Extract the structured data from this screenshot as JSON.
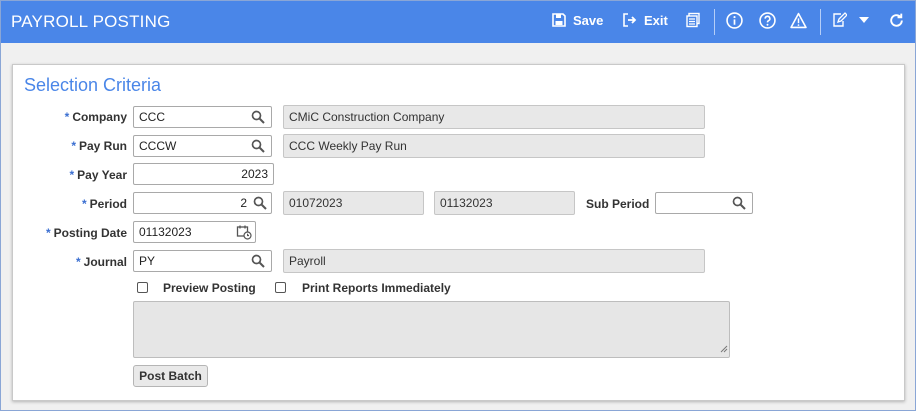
{
  "app": {
    "title": "PAYROLL POSTING"
  },
  "toolbar": {
    "save_label": "Save",
    "exit_label": "Exit",
    "icons": [
      "save-icon",
      "exit-icon",
      "reports-icon",
      "info-icon",
      "help-icon",
      "warning-icon",
      "edit-note-icon",
      "dropdown-arrow-icon",
      "refresh-icon"
    ]
  },
  "section": {
    "title": "Selection Criteria"
  },
  "required_marker": "*",
  "fields": {
    "company": {
      "label": "Company",
      "value": "CCC",
      "description": "CMiC Construction Company"
    },
    "pay_run": {
      "label": "Pay Run",
      "value": "CCCW",
      "description": "CCC Weekly Pay Run"
    },
    "pay_year": {
      "label": "Pay Year",
      "value": "2023"
    },
    "period": {
      "label": "Period",
      "value": "2",
      "start": "01072023",
      "end": "01132023"
    },
    "sub_period": {
      "label": "Sub Period",
      "value": ""
    },
    "posting_date": {
      "label": "Posting Date",
      "value": "01132023"
    },
    "journal": {
      "label": "Journal",
      "value": "PY",
      "description": "Payroll"
    }
  },
  "options": {
    "preview_posting": {
      "label": "Preview Posting",
      "checked": false
    },
    "print_reports": {
      "label": "Print Reports Immediately",
      "checked": false
    }
  },
  "actions": {
    "post_batch": "Post Batch"
  },
  "colors": {
    "header": "#4a86e8",
    "accent": "#4a86e8",
    "readonly_bg": "#e8e8e8"
  }
}
